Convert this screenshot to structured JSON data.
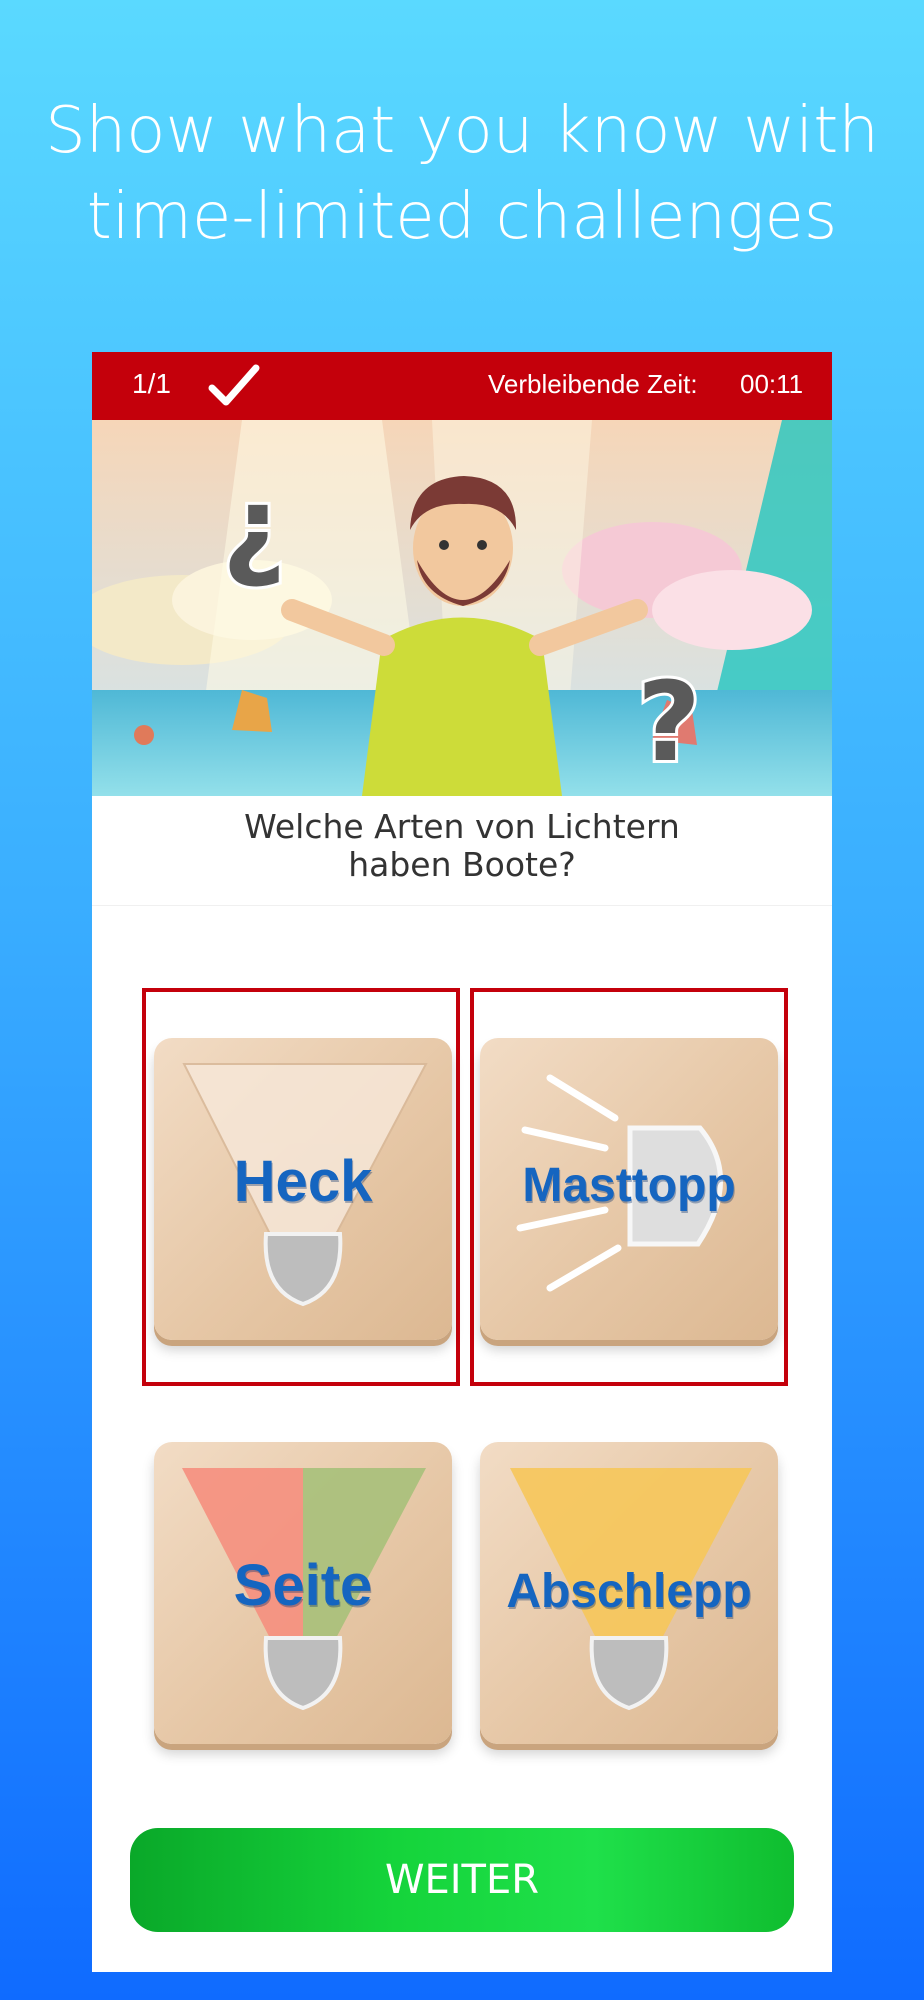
{
  "promo": {
    "line1": "Show what you know with",
    "line2": "time-limited challenges"
  },
  "topbar": {
    "counter": "1/1",
    "time_label": "Verbleibende Zeit:",
    "time_value": "00:11",
    "check_icon": "checkmark-icon"
  },
  "question": {
    "line1": "Welche Arten von Lichtern",
    "line2": "haben Boote?"
  },
  "answers": [
    {
      "label": "Heck",
      "selected": true
    },
    {
      "label": "Masttopp",
      "selected": true
    },
    {
      "label": "Seite",
      "selected": false
    },
    {
      "label": "Abschlepp",
      "selected": false
    }
  ],
  "continue_button": {
    "label": "WEITER"
  },
  "colors": {
    "topbar": "#c4000b",
    "answer_text": "#1565c0",
    "button_green": "#15d43b"
  }
}
